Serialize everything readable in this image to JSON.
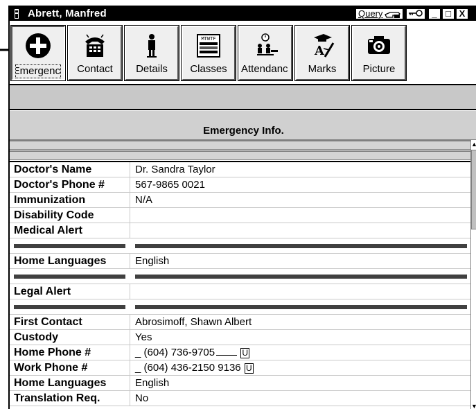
{
  "window": {
    "title": "Abrett, Manfred",
    "query_label": "Query",
    "min_glyph": "_",
    "max_glyph": "□",
    "close_glyph": "X"
  },
  "toolbar": {
    "buttons": [
      {
        "label": "Emergency",
        "display": "Emergenc",
        "icon": "plus-circle-icon",
        "active": true
      },
      {
        "label": "Contact",
        "icon": "telephone-icon"
      },
      {
        "label": "Details",
        "icon": "student-figure-icon"
      },
      {
        "label": "Classes",
        "icon": "schedule-grid-icon"
      },
      {
        "label": "Attendance",
        "display": "Attendanc",
        "icon": "attendance-clock-icon"
      },
      {
        "label": "Marks",
        "icon": "graduation-marks-icon"
      },
      {
        "label": "Picture",
        "icon": "camera-icon"
      }
    ]
  },
  "section": {
    "title": "Emergency Info."
  },
  "rows": {
    "doctor_name": {
      "label": "Doctor's Name",
      "value": "Dr. Sandra Taylor"
    },
    "doctor_phone": {
      "label": "Doctor's Phone #",
      "value": "567-9865 0021"
    },
    "immunization": {
      "label": "Immunization",
      "value": "N/A"
    },
    "disability_code": {
      "label": "Disability Code",
      "value": ""
    },
    "medical_alert": {
      "label": "Medical Alert",
      "value": ""
    },
    "home_languages_1": {
      "label": "Home Languages",
      "value": "English"
    },
    "legal_alert": {
      "label": "Legal Alert",
      "value": ""
    },
    "first_contact": {
      "label": "First Contact",
      "value": "Abrosimoff, Shawn Albert"
    },
    "custody": {
      "label": "Custody",
      "value": "Yes"
    },
    "home_phone": {
      "label": "Home Phone #",
      "prefix": "_",
      "value": "(604) 736-9705",
      "unlisted": "U"
    },
    "work_phone": {
      "label": "Work Phone #",
      "prefix": "_",
      "value": "(604) 436-2150 9136",
      "unlisted": "U"
    },
    "home_languages_2": {
      "label": "Home Languages",
      "value": "English"
    },
    "translation_req": {
      "label": "Translation Req.",
      "value": "No"
    }
  },
  "colors": {
    "titlebar": "#000000",
    "band": "#d4d4d4",
    "separator": "#404040"
  }
}
